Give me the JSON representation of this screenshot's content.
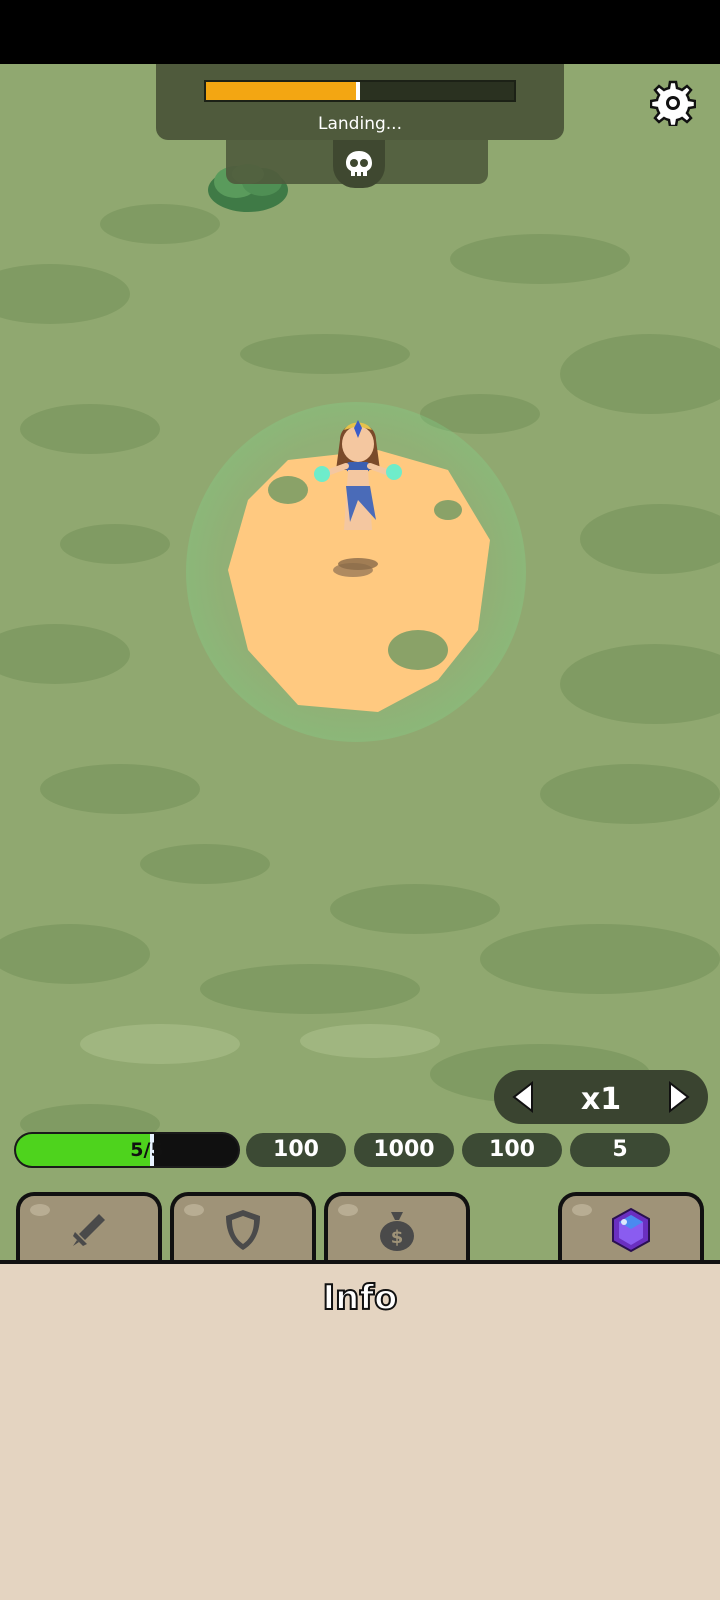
{
  "wave": {
    "status_text": "Landing...",
    "progress": 0.5
  },
  "speed": {
    "multiplier": "x1"
  },
  "hero_stats": {
    "health": "5/5",
    "health_fraction": 0.62,
    "values": [
      "100",
      "1000",
      "100",
      "5"
    ]
  },
  "tabs": [
    {
      "icon": "sword-icon"
    },
    {
      "icon": "shield-icon"
    },
    {
      "icon": "money-bag-icon"
    },
    {
      "icon": "purple-gem-icon"
    }
  ],
  "info": {
    "title": "Info"
  },
  "colors": {
    "grass": "#90a870",
    "sand": "#ffc980",
    "progress": "#f3a612",
    "health": "#4ed31d",
    "panel": "#e4d4c1"
  }
}
